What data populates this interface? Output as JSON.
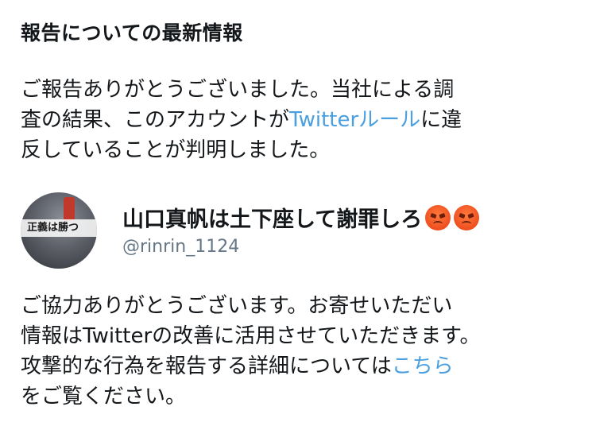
{
  "title": "報告についての最新情報",
  "report_update": {
    "line1": "ご報告ありがとうございました。当社による調",
    "line2_before": "査の結果、このアカウントが",
    "line2_link": "Twitterルール",
    "line2_after": "に違",
    "line3": "反していることが判明しました。"
  },
  "account": {
    "avatar_text": "正義は勝つ",
    "display_name": "山口真帆は土下座して謝罪しろ",
    "emoji": [
      "pouting-face",
      "pouting-face"
    ],
    "handle": "@rinrin_1124"
  },
  "thanks": {
    "line1": "ご協力ありがとうございます。お寄せいただい",
    "line2": "情報はTwitterの改善に活用させていただきます。",
    "line3_before": "攻撃的な行為を報告する詳細については",
    "line3_link": "こちら",
    "line4": "をご覧ください。"
  },
  "colors": {
    "link": "#4a9fe0",
    "text": "#14171a",
    "handle": "#657786"
  }
}
